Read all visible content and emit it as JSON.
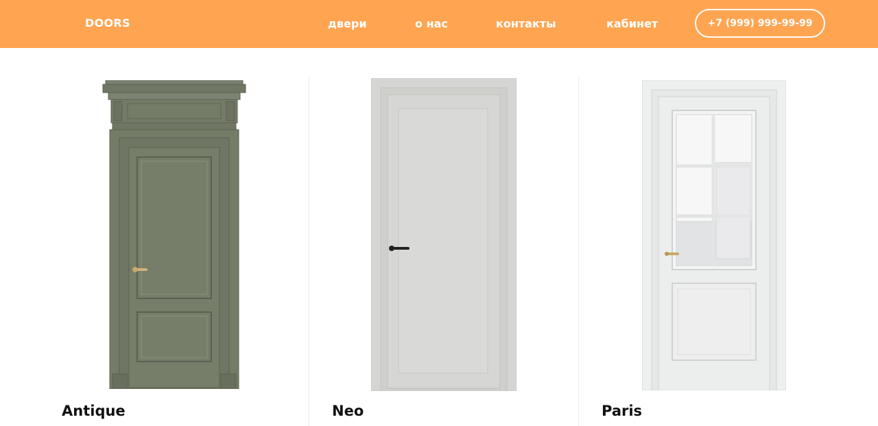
{
  "header": {
    "logo": "DOORS",
    "nav": [
      "двери",
      "о нас",
      "контакты",
      "кабинет"
    ],
    "phone": "+7 (999) 999-99-99",
    "background_color": "#FFA552",
    "text_color": "#FFFFFF"
  },
  "products": [
    {
      "name": "Antique",
      "door_color": "#747B67",
      "image": "antique-door-image"
    },
    {
      "name": "Neo",
      "door_color": "#D5D6D3",
      "image": "neo-door-image"
    },
    {
      "name": "Paris",
      "door_color": "#E9EAEA",
      "image": "paris-door-image"
    }
  ]
}
